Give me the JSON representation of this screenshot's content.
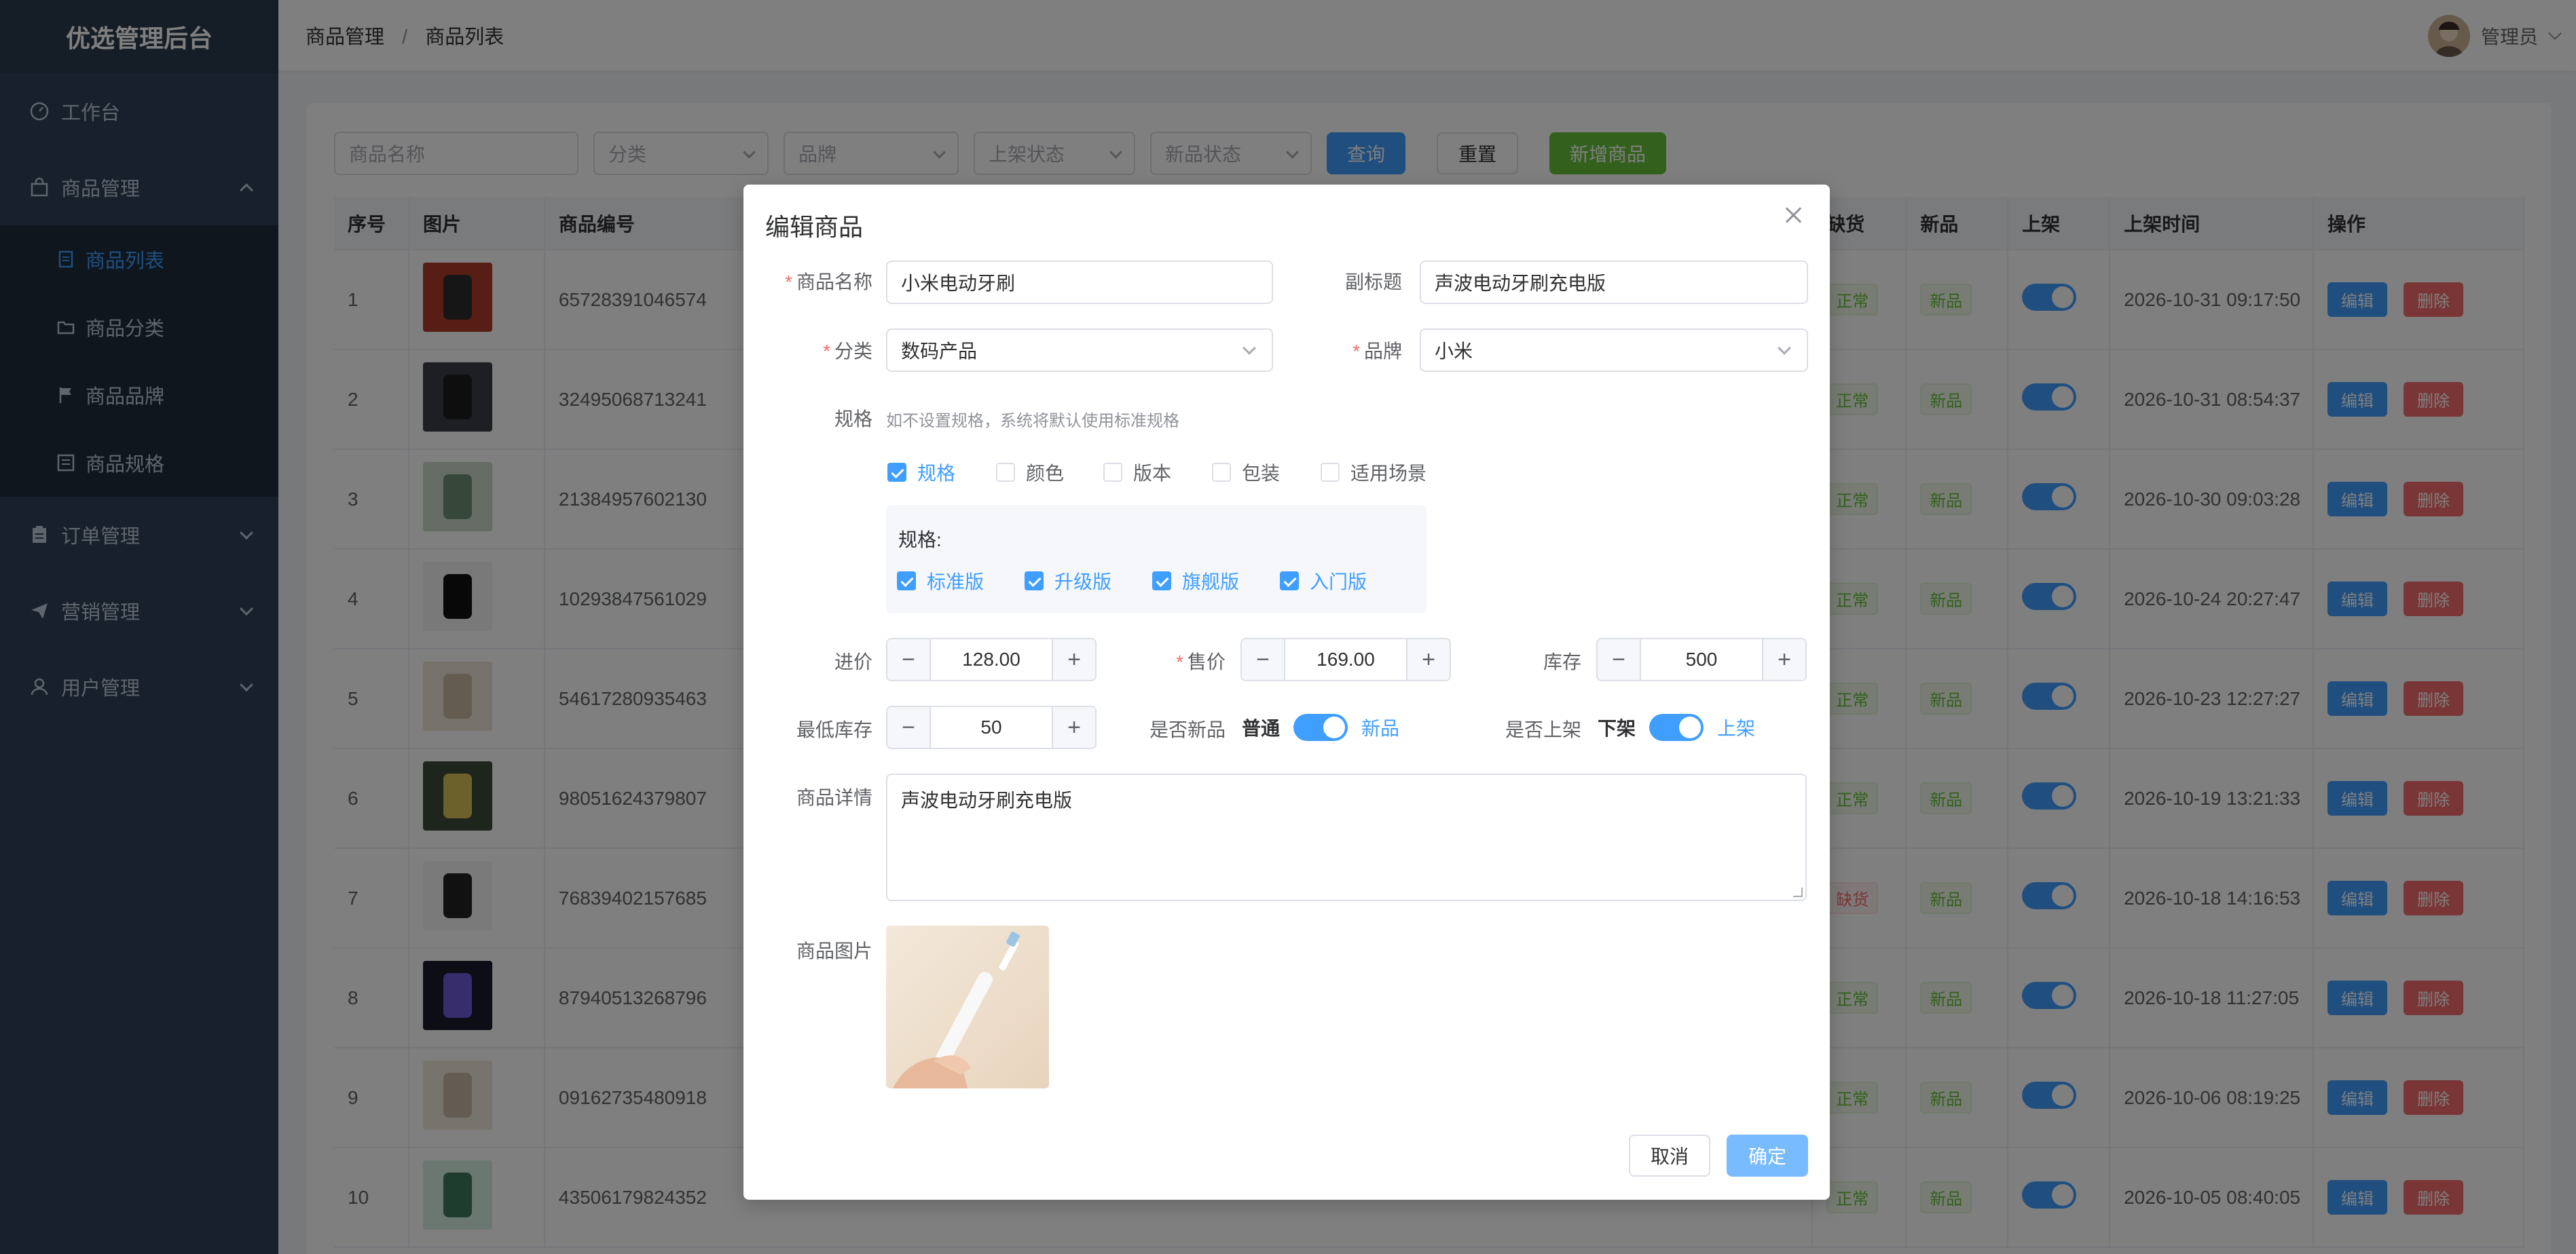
{
  "app": {
    "title": "优选管理后台"
  },
  "sidebar": {
    "items": [
      {
        "label": "工作台",
        "icon": "dashboard-icon"
      },
      {
        "label": "商品管理",
        "icon": "bag-icon",
        "expanded": true
      },
      {
        "label": "订单管理",
        "icon": "clipboard-icon"
      },
      {
        "label": "营销管理",
        "icon": "send-icon"
      },
      {
        "label": "用户管理",
        "icon": "user-icon"
      }
    ],
    "sub_items": [
      {
        "label": "商品列表",
        "icon": "document-icon",
        "active": true
      },
      {
        "label": "商品分类",
        "icon": "folder-icon"
      },
      {
        "label": "商品品牌",
        "icon": "flag-icon"
      },
      {
        "label": "商品规格",
        "icon": "list-icon"
      }
    ]
  },
  "header": {
    "breadcrumb": [
      "商品管理",
      "商品列表"
    ],
    "user_name": "管理员"
  },
  "filters": {
    "name_placeholder": "商品名称",
    "category_placeholder": "分类",
    "brand_placeholder": "品牌",
    "shelf_placeholder": "上架状态",
    "new_placeholder": "新品状态",
    "query_label": "查询",
    "reset_label": "重置",
    "add_label": "新增商品"
  },
  "table": {
    "columns": [
      "序号",
      "图片",
      "商品编号",
      "缺货",
      "新品",
      "上架",
      "上架时间",
      "操作"
    ],
    "edit_label": "编辑",
    "delete_label": "删除",
    "rows": [
      {
        "index": "1",
        "code": "65728391046574",
        "stock": "正常",
        "new": "新品",
        "time": "2026-10-31 09:17:50"
      },
      {
        "index": "2",
        "code": "32495068713241",
        "stock": "正常",
        "new": "新品",
        "time": "2026-10-31 08:54:37"
      },
      {
        "index": "3",
        "code": "21384957602130",
        "stock": "正常",
        "new": "新品",
        "time": "2026-10-30 09:03:28"
      },
      {
        "index": "4",
        "code": "10293847561029",
        "stock": "正常",
        "new": "新品",
        "time": "2026-10-24 20:27:47"
      },
      {
        "index": "5",
        "code": "54617280935463",
        "stock": "正常",
        "new": "新品",
        "time": "2026-10-23 12:27:27"
      },
      {
        "index": "6",
        "code": "98051624379807",
        "stock": "正常",
        "new": "新品",
        "time": "2026-10-19 13:21:33"
      },
      {
        "index": "7",
        "code": "76839402157685",
        "stock": "缺货",
        "new": "新品",
        "time": "2026-10-18 14:16:53"
      },
      {
        "index": "8",
        "code": "87940513268796",
        "stock": "正常",
        "new": "新品",
        "time": "2026-10-18 11:27:05"
      },
      {
        "index": "9",
        "code": "09162735480918",
        "stock": "正常",
        "new": "新品",
        "time": "2026-10-06 08:19:25"
      },
      {
        "index": "10",
        "code": "43506179824352",
        "stock": "正常",
        "new": "新品",
        "time": "2026-10-05 08:40:05"
      }
    ]
  },
  "dialog": {
    "title": "编辑商品",
    "name_label": "商品名称",
    "name_value": "小米电动牙刷",
    "subtitle_label": "副标题",
    "subtitle_value": "声波电动牙刷充电版",
    "category_label": "分类",
    "category_value": "数码产品",
    "brand_label": "品牌",
    "brand_value": "小米",
    "spec_label": "规格",
    "spec_hint": "如不设置规格，系统将默认使用标准规格",
    "spec_types": [
      {
        "label": "规格",
        "checked": true
      },
      {
        "label": "颜色",
        "checked": false
      },
      {
        "label": "版本",
        "checked": false
      },
      {
        "label": "包装",
        "checked": false
      },
      {
        "label": "适用场景",
        "checked": false
      }
    ],
    "spec_panel_title": "规格:",
    "spec_values": [
      {
        "label": "标准版",
        "checked": true
      },
      {
        "label": "升级版",
        "checked": true
      },
      {
        "label": "旗舰版",
        "checked": true
      },
      {
        "label": "入门版",
        "checked": true
      }
    ],
    "cost_label": "进价",
    "cost_value": "128.00",
    "price_label": "售价",
    "price_value": "169.00",
    "stock_label": "库存",
    "stock_value": "500",
    "min_stock_label": "最低库存",
    "min_stock_value": "50",
    "is_new_label": "是否新品",
    "is_new_off": "普通",
    "is_new_on": "新品",
    "on_shelf_label": "是否上架",
    "on_shelf_off": "下架",
    "on_shelf_on": "上架",
    "detail_label": "商品详情",
    "detail_value": "声波电动牙刷充电版",
    "image_label": "商品图片",
    "cancel_label": "取消",
    "confirm_label": "确定"
  },
  "colors": {
    "primary": "#409eff",
    "danger": "#f56c6c",
    "success": "#67c23a",
    "sidebar": "#304156"
  }
}
